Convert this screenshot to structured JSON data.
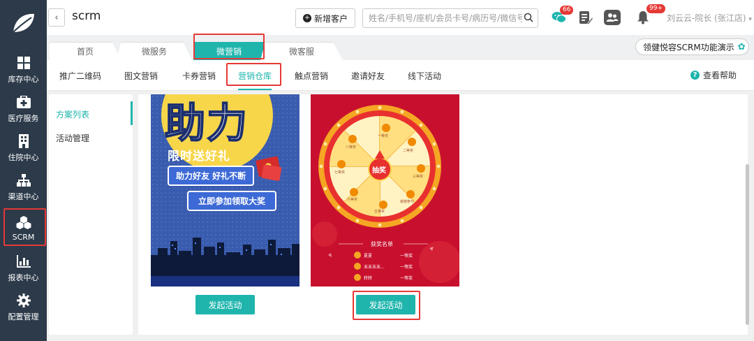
{
  "app": {
    "title": "scrm",
    "back_label": "‹"
  },
  "nav": {
    "items": [
      {
        "label": "库存中心",
        "icon": "grid-icon"
      },
      {
        "label": "医疗服务",
        "icon": "medical-kit-icon"
      },
      {
        "label": "住院中心",
        "icon": "hospital-building-icon"
      },
      {
        "label": "渠道中心",
        "icon": "org-chart-icon"
      },
      {
        "label": "SCRM",
        "icon": "cubes-icon"
      },
      {
        "label": "报表中心",
        "icon": "bar-chart-icon"
      },
      {
        "label": "配置管理",
        "icon": "gear-icon"
      }
    ],
    "active_index": 4
  },
  "header": {
    "new_customer": "新增客户",
    "search_placeholder": "姓名/手机号/座机/会员卡号/病历号/微信号",
    "wechat_badge": "66",
    "bell_badge": "99+",
    "user": "刘云云-院长 (张江店)"
  },
  "tabs": {
    "items": [
      "首页",
      "微服务",
      "微营销",
      "微客服"
    ],
    "active_index": 2,
    "demo": "领健悦容SCRM功能演示"
  },
  "subnav": {
    "items": [
      "推广二维码",
      "图文营销",
      "卡券营销",
      "营销仓库",
      "触点营销",
      "邀请好友",
      "线下活动"
    ],
    "active_index": 3,
    "help": "查看帮助"
  },
  "side": {
    "items": [
      "方案列表",
      "活动管理"
    ],
    "active_index": 0
  },
  "cards": [
    {
      "poster_big": "助力",
      "poster_sub": "限时送好礼",
      "pill1": "助力好友 好礼不断",
      "pill2": "立即参加领取大奖",
      "button": "发起活动"
    },
    {
      "wheel_center": "抽奖",
      "prize_labels": [
        "一等奖",
        "二等奖",
        "三等奖",
        "谢谢参与",
        "五等奖",
        "六等奖",
        "七等奖",
        "八等奖"
      ],
      "winners_title": "获奖名单",
      "winners": [
        {
          "name": "夏夏",
          "prize": "一等奖"
        },
        {
          "name": "末末末末...",
          "prize": "一等奖"
        },
        {
          "name": "转转",
          "prize": "一等奖"
        }
      ],
      "button": "发起活动"
    }
  ],
  "colors": {
    "accent": "#1fb5ad",
    "nav_bg": "#2c3a4a",
    "highlight": "#e53935"
  }
}
